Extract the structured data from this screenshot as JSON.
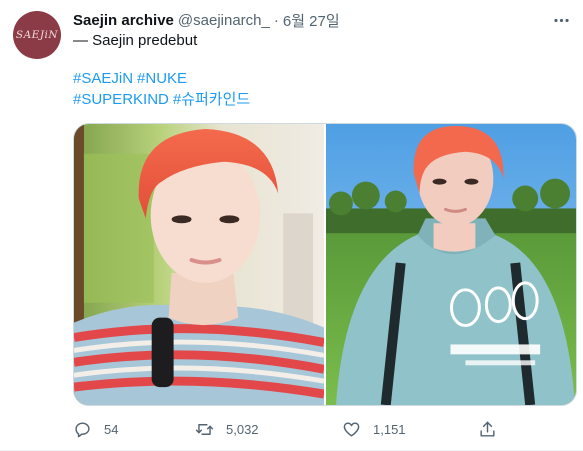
{
  "tweet": {
    "avatar_text": "SAEJiN",
    "display_name": "Saejin archive",
    "handle": "@saejinarch_",
    "separator": "·",
    "date": "6월 27일",
    "text": "— Saejin predebut",
    "hashtags_line1": [
      "#SAEJiN",
      "#NUKE"
    ],
    "hashtags_line2": [
      "#SUPERKIND",
      "#슈퍼카인드"
    ]
  },
  "actions": {
    "reply_count": "54",
    "retweet_count": "5,032",
    "like_count": "1,151"
  },
  "colors": {
    "accent": "#1d9bf0",
    "muted": "#536471",
    "text": "#0f1419",
    "avatar_bg": "#8a3b46"
  },
  "icons": [
    "more-icon",
    "reply-icon",
    "retweet-icon",
    "like-icon",
    "share-icon"
  ]
}
